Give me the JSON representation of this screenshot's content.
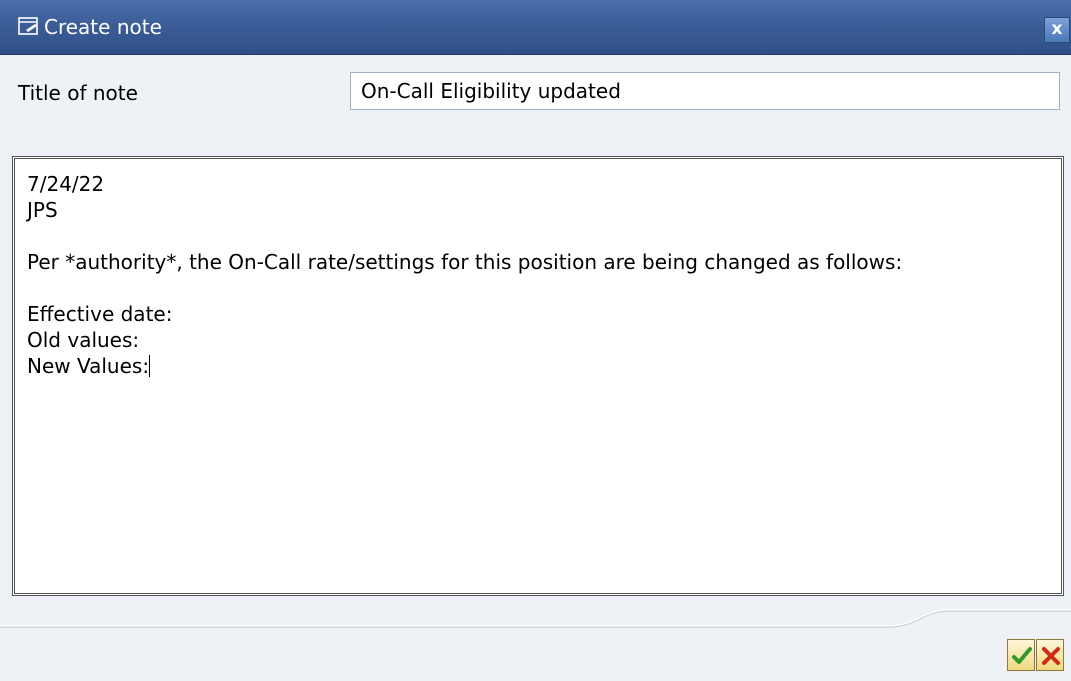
{
  "window": {
    "title": "Create note",
    "close_symbol": "x"
  },
  "form": {
    "title_label": "Title of note",
    "title_value": "On-Call Eligibility updated"
  },
  "editor": {
    "lines": [
      "7/24/22",
      "JPS",
      "",
      "Per *authority*, the On-Call rate/settings for this position are being changed as follows:",
      "",
      "Effective date:",
      "Old values:",
      "New Values:"
    ]
  },
  "footer": {
    "ok_icon": "checkmark-icon",
    "cancel_icon": "x-icon"
  },
  "colors": {
    "titlebar": "#3c5e98",
    "background": "#eef2f6",
    "ok_check": "#2e9a2e",
    "cancel_x": "#d02a10"
  }
}
